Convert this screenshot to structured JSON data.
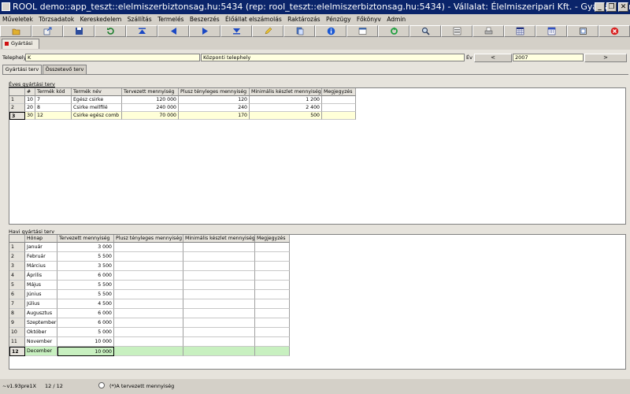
{
  "window": {
    "title": "ROOL demo::app_teszt::elelmiszerbiztonsag.hu:5434 (rep: rool_teszt::elelmiszerbiztonsag.hu:5434) - Vállalat: Élelmiszeripari Kft. - Gyártási terv",
    "btn_min": "_",
    "btn_max": "❐",
    "btn_close": "✕"
  },
  "menu": [
    "Műveletek",
    "Törzsadatok",
    "Kereskedelem",
    "Szállítás",
    "Termelés",
    "Beszerzés",
    "Élőállat elszámolás",
    "Raktározás",
    "Pénzügy",
    "Főkönyv",
    "Admin"
  ],
  "toolbar_icons": [
    "open-folder-icon",
    "export-icon",
    "save-icon",
    "refresh-icon",
    "first-record-icon",
    "previous-record-icon",
    "next-record-icon",
    "last-record-icon",
    "edit-icon",
    "copy-icon",
    "info-icon",
    "window-icon",
    "recycle-icon",
    "search-icon",
    "list-icon",
    "print-icon",
    "grid-icon",
    "calendar-icon",
    "maximize-icon",
    "close-icon"
  ],
  "doc_tab": "Gyártási terv",
  "form": {
    "telephely_label": "Telephely",
    "telephely_code": "K",
    "telephely_name": "Központi telephely",
    "ev_label": "Év",
    "prev": "<",
    "year": "2007",
    "next": ">"
  },
  "tabs": [
    "Gyártási terv",
    "Összetevő terv"
  ],
  "annual": {
    "section_title": "Éves gyártási terv",
    "columns": [
      "#",
      "Termék kód",
      "Termék név",
      "Tervezett mennyiség",
      "Plusz tényleges mennyiség",
      "Minimális készlet mennyiség",
      "Megjegyzés"
    ],
    "rows": [
      {
        "rh": "1",
        "n": "10",
        "code": "7",
        "name": "Egész csirke",
        "plan": "120 000",
        "plus": "120",
        "min": "1 200",
        "note": ""
      },
      {
        "rh": "2",
        "n": "20",
        "code": "8",
        "name": "Csirke mellfilé",
        "plan": "240 000",
        "plus": "240",
        "min": "2 400",
        "note": ""
      },
      {
        "rh": "3",
        "n": "30",
        "code": "12",
        "name": "Csirke egész comb",
        "plan": "70 000",
        "plus": "170",
        "min": "500",
        "note": ""
      }
    ]
  },
  "monthly": {
    "section_title": "Havi gyártási terv",
    "columns": [
      "Hónap",
      "Tervezett mennyiség",
      "Plusz tényleges mennyiség",
      "Minimális készlet mennyiség",
      "Megjegyzés"
    ],
    "rows": [
      {
        "rh": "1",
        "month": "Január",
        "plan": "3 000"
      },
      {
        "rh": "2",
        "month": "Február",
        "plan": "5 500"
      },
      {
        "rh": "3",
        "month": "Március",
        "plan": "3 500"
      },
      {
        "rh": "4",
        "month": "Április",
        "plan": "6 000"
      },
      {
        "rh": "5",
        "month": "Május",
        "plan": "5 500"
      },
      {
        "rh": "6",
        "month": "Június",
        "plan": "5 500"
      },
      {
        "rh": "7",
        "month": "Július",
        "plan": "4 500"
      },
      {
        "rh": "8",
        "month": "Augusztus",
        "plan": "6 000"
      },
      {
        "rh": "9",
        "month": "Szeptember",
        "plan": "6 000"
      },
      {
        "rh": "10",
        "month": "Október",
        "plan": "5 000"
      },
      {
        "rh": "11",
        "month": "November",
        "plan": "10 000"
      },
      {
        "rh": "12",
        "month": "December",
        "plan": "10 000"
      }
    ]
  },
  "status": {
    "version": "~v1.93pre1X",
    "position": "12 / 12",
    "legend": "(*)A tervezett mennyiség"
  }
}
